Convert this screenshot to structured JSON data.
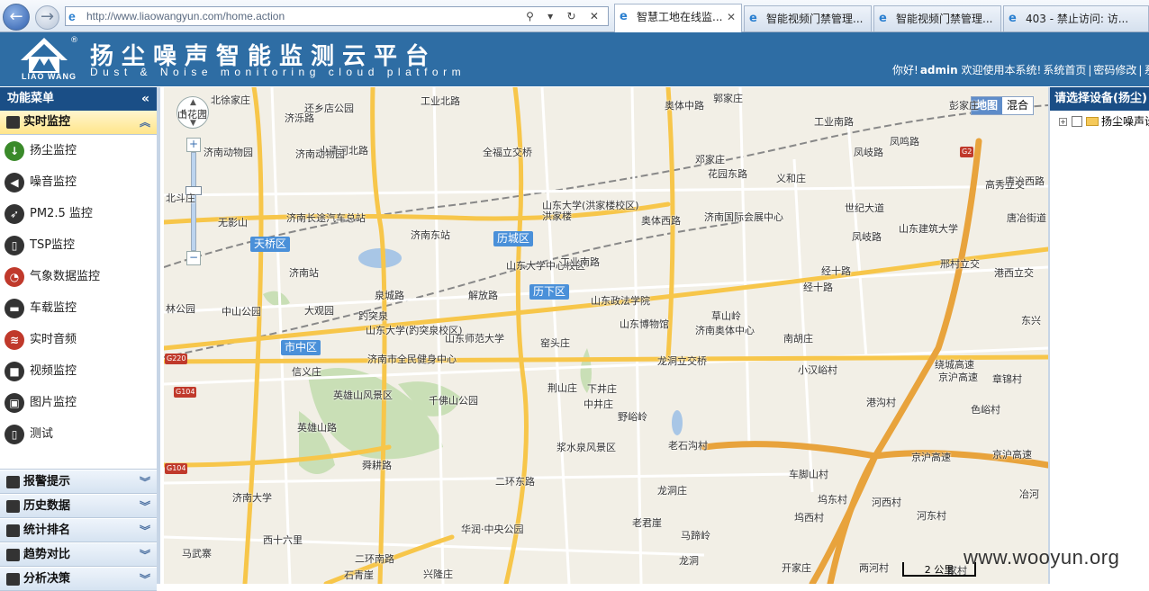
{
  "browser": {
    "url": "http://www.liaowangyun.com/home.action",
    "tabs": [
      {
        "label": "智慧工地在线监...",
        "active": true
      },
      {
        "label": "智能视频门禁管理...",
        "active": false
      },
      {
        "label": "智能视频门禁管理...",
        "active": false
      },
      {
        "label": "403 - 禁止访问: 访...",
        "active": false
      }
    ],
    "address_tools": "⚲ ▾ ↻ ✕"
  },
  "header": {
    "logo_text": "LIAO WANG",
    "registered": "®",
    "title": "扬尘噪声智能监测云平台",
    "subtitle": "Dust & Noise monitoring cloud platform",
    "welcome_prefix": "你好!",
    "username": "admin",
    "welcome_suffix": "欢迎使用本系统!",
    "home_link": "系统首页",
    "separator": "|",
    "password_link": "密码修改",
    "separator2": "|",
    "trailing": "系"
  },
  "sidebar": {
    "title": "功能菜单",
    "collapse_glyph": "«",
    "active_group": "实时监控",
    "items": [
      {
        "label": "扬尘监控",
        "icon": "download-arrow-icon",
        "color": "#3a8a2a",
        "glyph": "↓"
      },
      {
        "label": "噪音监控",
        "icon": "speaker-icon",
        "color": "#333333",
        "glyph": "◀"
      },
      {
        "label": "PM2.5 监控",
        "icon": "rocket-icon",
        "color": "#333333",
        "glyph": "➶"
      },
      {
        "label": "TSP监控",
        "icon": "bucket-icon",
        "color": "#333333",
        "glyph": "▯"
      },
      {
        "label": "气象数据监控",
        "icon": "gauge-icon",
        "color": "#c0392b",
        "glyph": "◔"
      },
      {
        "label": "车载监控",
        "icon": "car-icon",
        "color": "#333333",
        "glyph": "▬"
      },
      {
        "label": "实时音频",
        "icon": "rss-icon",
        "color": "#c0392b",
        "glyph": "≋"
      },
      {
        "label": "视频监控",
        "icon": "camera-icon",
        "color": "#333333",
        "glyph": "■"
      },
      {
        "label": "图片监控",
        "icon": "picture-icon",
        "color": "#333333",
        "glyph": "▣"
      },
      {
        "label": "测试",
        "icon": "bucket-icon",
        "color": "#333333",
        "glyph": "▯"
      }
    ],
    "groups": [
      "报警提示",
      "历史数据",
      "统计排名",
      "趋势对比",
      "分析决策"
    ],
    "group_chevron": "︾",
    "active_chevron": "︽"
  },
  "map": {
    "type_map": "地图",
    "type_hybrid": "混合",
    "scale": "2 公里",
    "districts": [
      "天桥区",
      "历城区",
      "历下区",
      "市中区"
    ],
    "road_signs": [
      "G2",
      "G220",
      "G104",
      "G104"
    ],
    "labels": [
      "北徐家庄",
      "还乡店公园",
      "工业北路",
      "奥体中路",
      "郭家庄",
      "山花园",
      "济泺路",
      "小清河北路",
      "全福立交桥",
      "济南动物园",
      "济南动物园",
      "邓家庄",
      "花园东路",
      "义和庄",
      "工业南路",
      "凤岐路",
      "凤鸣路",
      "唐冶西路",
      "北斗庄",
      "无影山",
      "济南长途汽车总站",
      "济南东站",
      "山东大学(洪家楼校区)",
      "济南国际会展中心",
      "世纪大道",
      "山东建筑大学",
      "高秀立交",
      "唐冶街道",
      "济南站",
      "泉城路",
      "解放路",
      "山东大学中心校区",
      "工业南路",
      "经十路",
      "邢村立交",
      "港西立交",
      "林公园",
      "中山公园",
      "大观园",
      "趵突泉",
      "山东大学(趵突泉校区)",
      "山东师范大学",
      "山东政法学院",
      "山东博物馆",
      "草山岭",
      "济南奥体中心",
      "南胡庄",
      "东兴",
      "信义庄",
      "济南市全民健身中心",
      "窑头庄",
      "龙洞立交桥",
      "小汉峪村",
      "京沪高速",
      "章锦村",
      "英雄山风景区",
      "千佛山公园",
      "荆山庄",
      "下井庄",
      "中井庄",
      "港沟村",
      "色峪村",
      "野峪岭",
      "老石沟村",
      "浆水泉风景区",
      "京沪高速",
      "京沪高速",
      "二环东路",
      "济南大学",
      "龙洞庄",
      "车脚山村",
      "坞东村",
      "河西村",
      "冶河",
      "老君崖",
      "马蹄岭",
      "坞西村",
      "河东村",
      "马武寨",
      "华润·中央公园",
      "西十六里",
      "二环南路",
      "石青崖",
      "兴隆庄",
      "龙洞",
      "开家庄",
      "两河村",
      "家村",
      "英雄山路",
      "舜耕路",
      "奥体西路",
      "凤岐路",
      "经十路",
      "绕城高速",
      "彭家庄",
      "洪家楼"
    ]
  },
  "right_panel": {
    "title": "请选择设备(扬尘)",
    "tree_root": "扬尘噪声设",
    "expand_glyph": "+"
  },
  "watermark": "www.wooyun.org"
}
